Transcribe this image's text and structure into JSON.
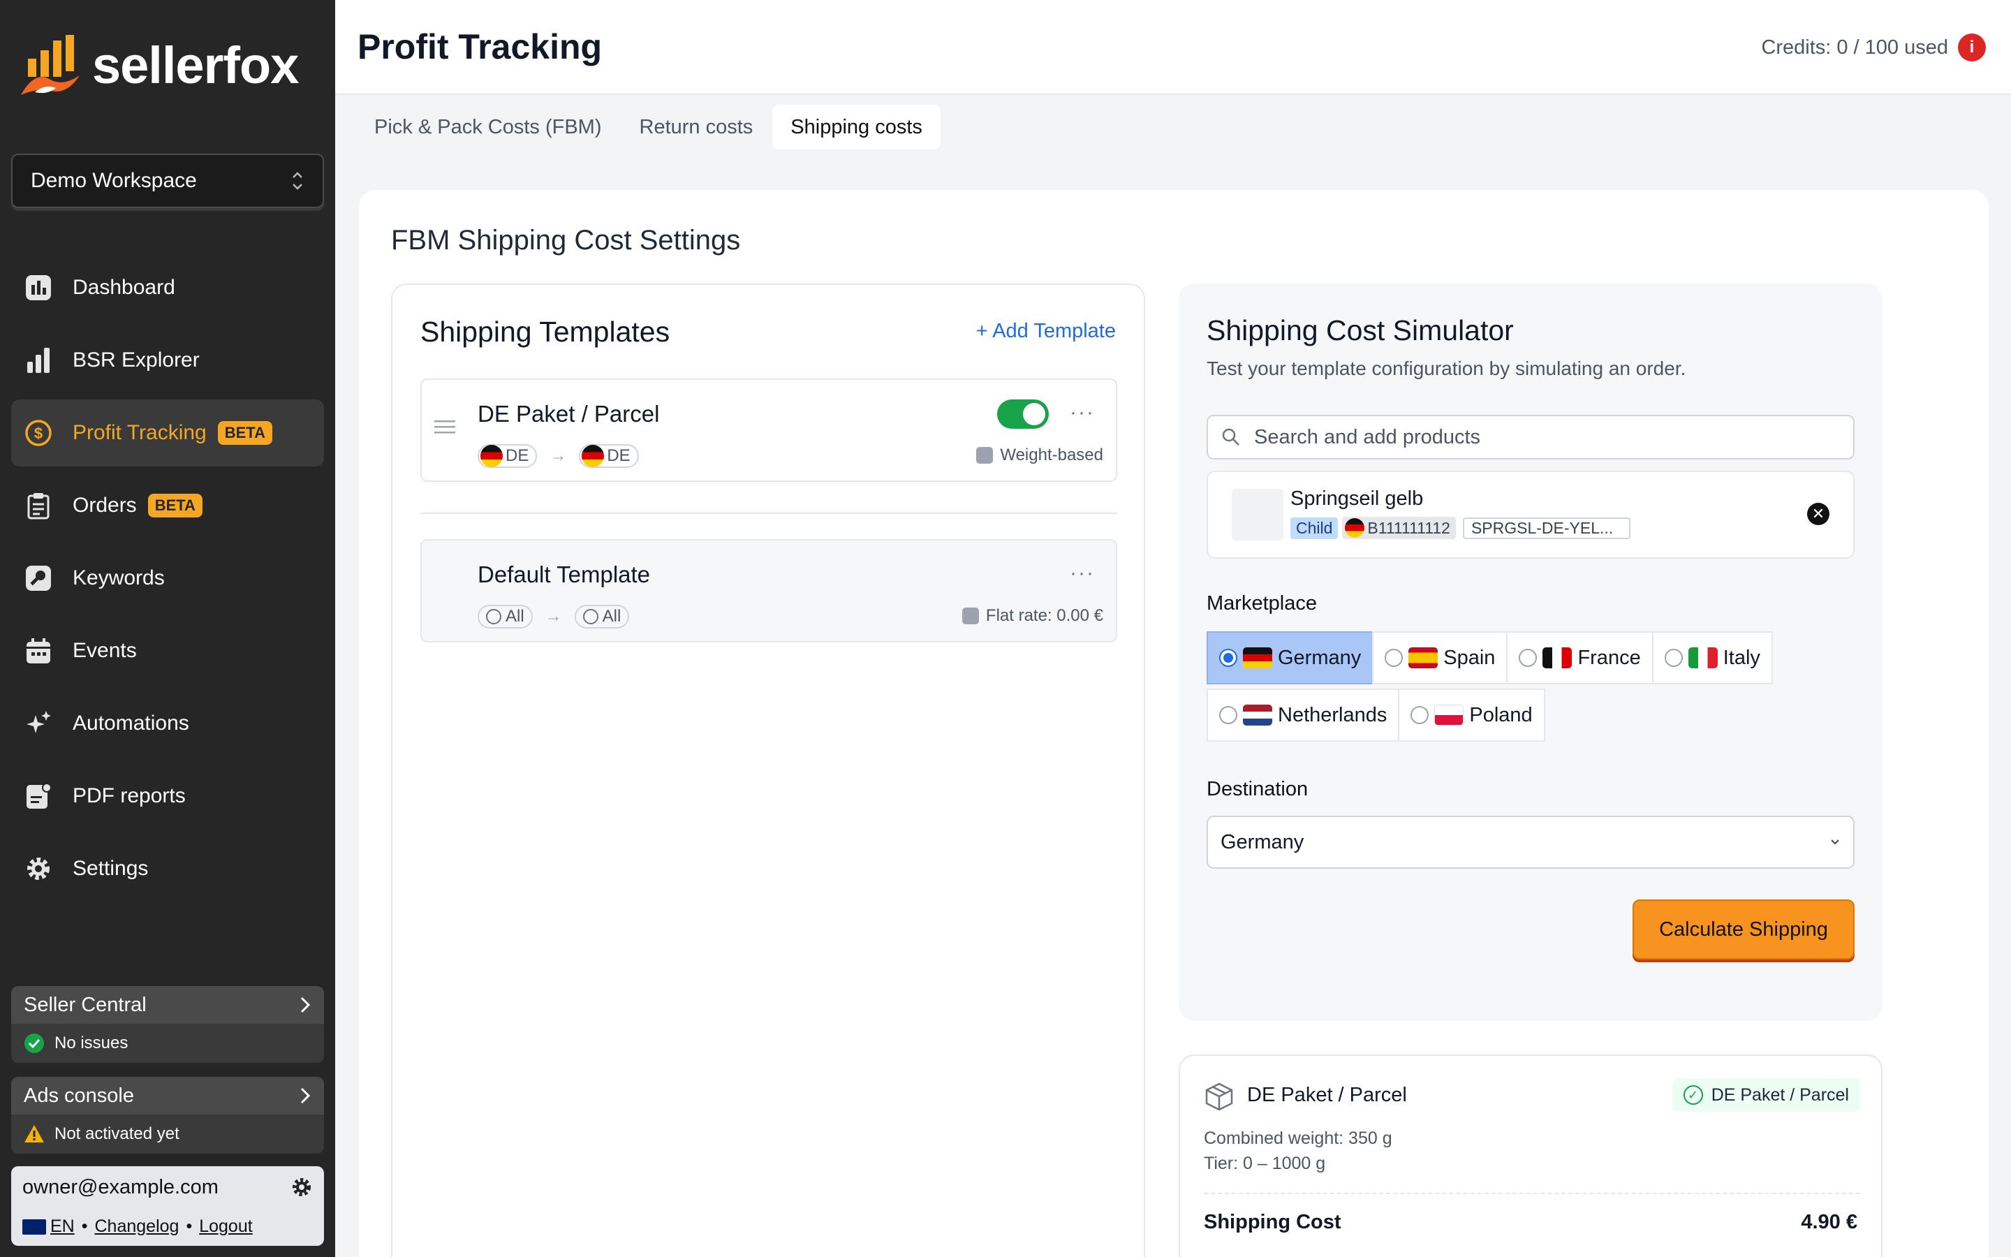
{
  "app": {
    "brand": "sellerfox"
  },
  "sidebar": {
    "workspace": "Demo Workspace",
    "items": [
      {
        "label": "Dashboard",
        "icon": "dashboard-icon"
      },
      {
        "label": "BSR Explorer",
        "icon": "bar-chart-icon"
      },
      {
        "label": "Profit Tracking",
        "icon": "dollar-circle-icon",
        "badge": "BETA",
        "active": true
      },
      {
        "label": "Orders",
        "icon": "clipboard-icon",
        "badge": "BETA"
      },
      {
        "label": "Keywords",
        "icon": "key-icon"
      },
      {
        "label": "Events",
        "icon": "calendar-icon"
      },
      {
        "label": "Automations",
        "icon": "sparkles-icon"
      },
      {
        "label": "PDF reports",
        "icon": "report-icon"
      },
      {
        "label": "Settings",
        "icon": "gear-icon"
      }
    ],
    "seller_central": {
      "title": "Seller Central",
      "status": "No issues"
    },
    "ads_console": {
      "title": "Ads console",
      "status": "Not activated yet"
    },
    "user": {
      "email": "owner@example.com",
      "lang": "EN",
      "changelog": "Changelog",
      "logout": "Logout",
      "sep": "•"
    }
  },
  "header": {
    "title": "Profit Tracking",
    "credits": "Credits: 0 / 100 used",
    "credits_info": "i"
  },
  "tabs": [
    {
      "label": "Pick & Pack Costs (FBM)",
      "active": false
    },
    {
      "label": "Return costs",
      "active": false
    },
    {
      "label": "Shipping costs",
      "active": true
    }
  ],
  "main": {
    "title": "FBM Shipping Cost Settings",
    "templates": {
      "title": "Shipping Templates",
      "add": "+ Add Template",
      "items": [
        {
          "name": "DE Paket / Parcel",
          "from": "DE",
          "to": "DE",
          "type": "Weight-based",
          "enabled": true
        },
        {
          "name": "Default Template",
          "from": "All",
          "to": "All",
          "type": "Flat rate: 0.00 €"
        }
      ]
    },
    "simulator": {
      "title": "Shipping Cost Simulator",
      "subtitle": "Test your template configuration by simulating an order.",
      "search_placeholder": "Search and add products",
      "product": {
        "name": "Springseil gelb",
        "variant": "Child",
        "asin": "B111111112",
        "sku": "SPRGSL-DE-YEL..."
      },
      "marketplace_label": "Marketplace",
      "marketplaces": [
        {
          "name": "Germany",
          "flag": "de",
          "selected": true
        },
        {
          "name": "Spain",
          "flag": "es"
        },
        {
          "name": "France",
          "flag": "fr"
        },
        {
          "name": "Italy",
          "flag": "it"
        },
        {
          "name": "Netherlands",
          "flag": "nl"
        },
        {
          "name": "Poland",
          "flag": "pl"
        }
      ],
      "destination_label": "Destination",
      "destination": "Germany",
      "calculate": "Calculate Shipping"
    },
    "result": {
      "template": "DE Paket / Parcel",
      "tag": "DE Paket / Parcel",
      "weight": "Combined weight: 350 g",
      "tier": "Tier: 0 – 1000 g",
      "cost_label": "Shipping Cost",
      "cost": "4.90 €"
    }
  },
  "colors": {
    "accent": "#f5a623",
    "sidebar": "#262626",
    "link": "#1d6ce0",
    "success": "#16a34a",
    "button": "#f7931e"
  }
}
